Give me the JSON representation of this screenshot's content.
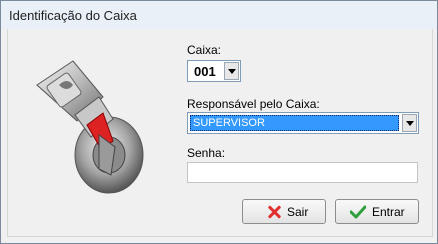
{
  "window": {
    "title": "Identificação do Caixa"
  },
  "form": {
    "caixa": {
      "label": "Caixa:",
      "value": "001"
    },
    "responsavel": {
      "label": "Responsável pelo Caixa:",
      "value": "SUPERVISOR"
    },
    "senha": {
      "label": "Senha:",
      "value": ""
    }
  },
  "buttons": {
    "sair": "Sair",
    "entrar": "Entrar"
  },
  "icons": {
    "logo": "key-lock-icon",
    "sair": "close-icon",
    "entrar": "check-icon",
    "dropdown": "chevron-down-icon"
  },
  "colors": {
    "selection": "#3399ff",
    "sair_icon": "#e23030",
    "entrar_icon": "#2f9e3c"
  }
}
